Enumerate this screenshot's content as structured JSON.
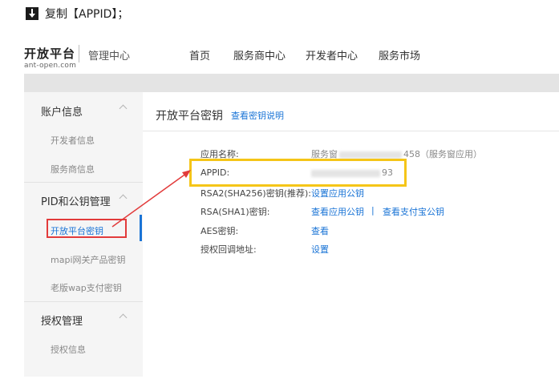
{
  "caption": {
    "icon": "down-arrow-icon",
    "text": "复制【APPID】；"
  },
  "header": {
    "logo_title": "开放平台",
    "logo_sub": "ant-open.com",
    "logo_center": "管理中心",
    "nav": [
      "首页",
      "服务商中心",
      "开发者中心",
      "服务市场"
    ]
  },
  "sidebar": {
    "groups": [
      {
        "label": "账户信息",
        "items": [
          "开发者信息",
          "服务商信息"
        ]
      },
      {
        "label": "PID和公钥管理",
        "items": [
          "开放平台密钥",
          "mapi网关产品密钥",
          "老版wap支付密钥"
        ]
      },
      {
        "label": "授权管理",
        "items": [
          "授权信息"
        ]
      }
    ],
    "active_item": "开放平台密钥"
  },
  "main": {
    "title": "开放平台密钥",
    "help_link": "查看密钥说明",
    "rows": [
      {
        "label": "应用名称:",
        "value_prefix": "服务窗",
        "value_suffix": "458（服务窗应用）"
      },
      {
        "label": "APPID:",
        "value_suffix": "93"
      },
      {
        "label": "RSA2(SHA256)密钥(推荐):",
        "link": "设置应用公钥"
      },
      {
        "label": "RSA(SHA1)密钥:",
        "links": [
          "查看应用公钥",
          "查看支付宝公钥"
        ],
        "separator": "|"
      },
      {
        "label": "AES密钥:",
        "link": "查看"
      },
      {
        "label": "授权回调地址:",
        "link": "设置"
      }
    ]
  },
  "colors": {
    "link": "#1a74d6",
    "highlight_yellow": "#f5c518",
    "highlight_red": "#e23b3b"
  }
}
